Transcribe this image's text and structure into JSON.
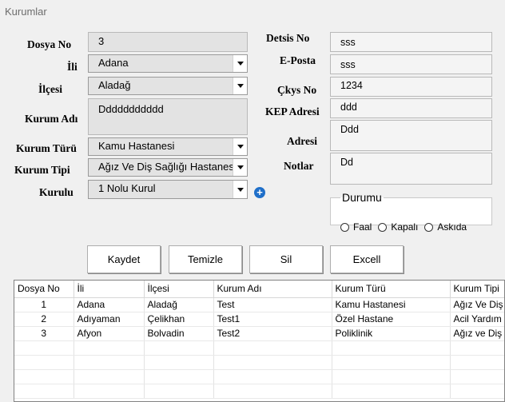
{
  "window": {
    "title": "Kurumlar"
  },
  "form": {
    "dosya_no": {
      "label": "Dosya No",
      "value": "3"
    },
    "ili": {
      "label": "İli",
      "value": "Adana"
    },
    "ilcesi": {
      "label": "İlçesi",
      "value": "Aladağ"
    },
    "kurum_adi": {
      "label": "Kurum Adı",
      "value": "Ddddddddddd"
    },
    "kurum_turu": {
      "label": "Kurum Türü",
      "value": "Kamu Hastanesi"
    },
    "kurum_tipi": {
      "label": "Kurum Tipi",
      "value": "Ağız Ve Diş Sağlığı Hastanesi"
    },
    "kurulu": {
      "label": "Kurulu",
      "value": "1 Nolu Kurul"
    },
    "detsis_no": {
      "label": "Detsis  No",
      "value": "sss"
    },
    "e_posta": {
      "label": "E-Posta",
      "value": "sss"
    },
    "ckys_no": {
      "label": "Çkys No",
      "value": "1234"
    },
    "kep_adresi": {
      "label": "KEP Adresi",
      "value": "ddd"
    },
    "adresi": {
      "label": "Adresi",
      "value": "Ddd"
    },
    "notlar": {
      "label": "Notlar",
      "value": "Dd"
    }
  },
  "durumu": {
    "legend": "Durumu",
    "options": [
      {
        "label": "Faal"
      },
      {
        "label": "Kapalı"
      },
      {
        "label": "Askıda"
      }
    ]
  },
  "buttons": {
    "kaydet": "Kaydet",
    "temizle": "Temizle",
    "sil": "Sil",
    "excell": "Excell"
  },
  "table": {
    "columns": [
      "Dosya No",
      "İli",
      "İlçesi",
      "Kurum Adı",
      "Kurum Türü",
      "Kurum Tipi"
    ],
    "rows": [
      [
        "1",
        "Adana",
        "Aladağ",
        "Test",
        "Kamu Hastanesi",
        "Ağız Ve Diş"
      ],
      [
        "2",
        "Adıyaman",
        "Çelikhan",
        "Test1",
        "Özel Hastane",
        "Acil Yardım"
      ],
      [
        "3",
        "Afyon",
        "Bolvadin",
        "Test2",
        "Poliklinik",
        "Ağız ve Diş"
      ]
    ]
  }
}
